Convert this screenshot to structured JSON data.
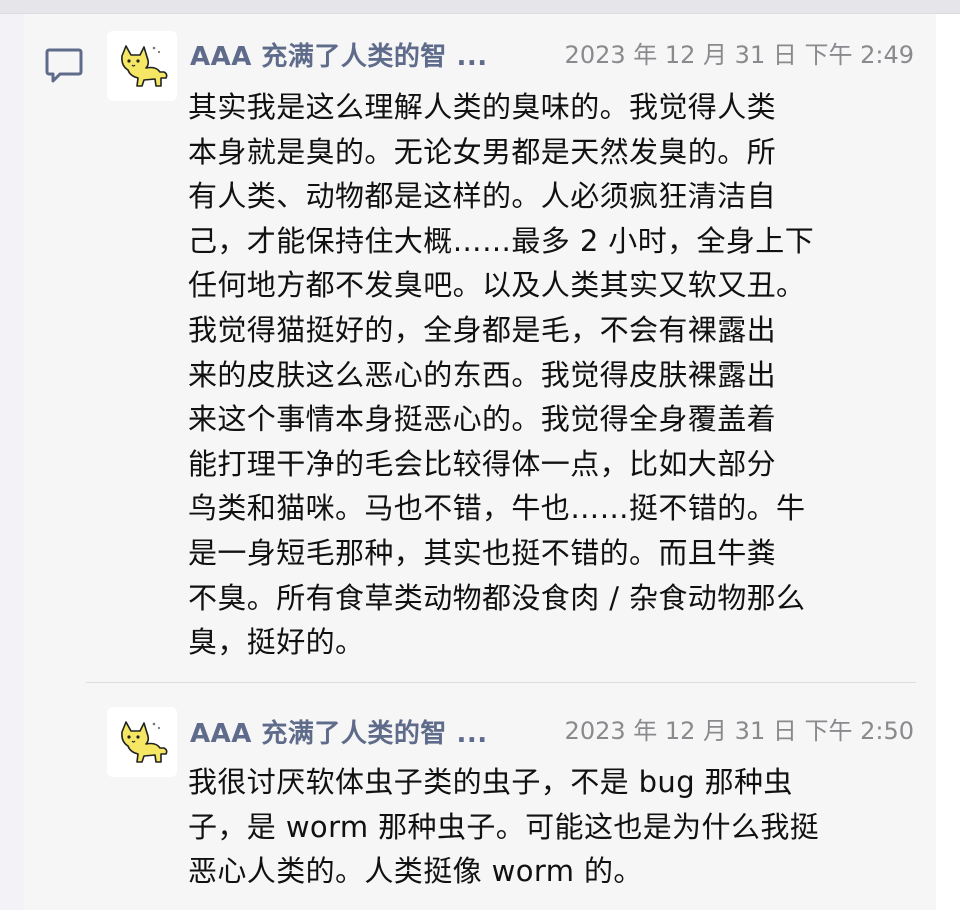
{
  "posts": [
    {
      "author": "AAA 充满了人类的智 ...",
      "time": "2023 年 12 月 31 日  下午 2:49",
      "text": "其实我是这么理解人类的臭味的。我觉得人类\n本身就是臭的。无论女男都是天然发臭的。所\n有人类、动物都是这样的。人必须疯狂清洁自\n己，才能保持住大概……最多 2 小时，全身上下\n任何地方都不发臭吧。以及人类其实又软又丑。\n我觉得猫挺好的，全身都是毛，不会有裸露出\n来的皮肤这么恶心的东西。我觉得皮肤裸露出\n来这个事情本身挺恶心的。我觉得全身覆盖着\n能打理干净的毛会比较得体一点，比如大部分\n鸟类和猫咪。马也不错，牛也……挺不错的。牛\n是一身短毛那种，其实也挺不错的。而且牛粪\n不臭。所有食草类动物都没食肉 / 杂食动物那么\n臭，挺好的。"
    },
    {
      "author": "AAA 充满了人类的智 ...",
      "time": "2023 年 12 月 31 日  下午 2:50",
      "text": "我很讨厌软体虫子类的虫子，不是 bug 那种虫\n子，是 worm 那种虫子。可能这也是为什么我挺\n恶心人类的。人类挺像 worm 的。"
    }
  ],
  "icons": {
    "comment": "comment-icon",
    "avatar": "cat-avatar-icon"
  },
  "colors": {
    "author": "#5f6b8a",
    "time": "#8a8a8e",
    "text": "#111111",
    "avatar_cat": "#f5e663"
  }
}
